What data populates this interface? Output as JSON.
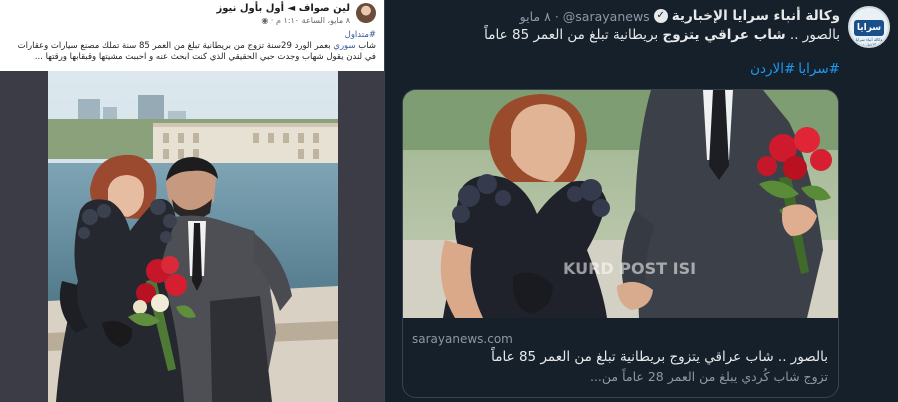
{
  "facebook_post": {
    "author_name": "لين صواف ◄ أول بأول نيوز",
    "timestamp": "٨ مايو، الساعة ١:١٠ م · ◉",
    "hashtag": "#متداول",
    "body_before": "شاب ",
    "body_highlight": "سوري",
    "body_after": " بعمر الورد 29سنة تزوج من بريطانية تبلغ من العمر 85 سنة تملك مصنع سيارات وعقارات في لندن يقول شهاب وجدت حبي الحقيقي الذي كنت ابحث عنه و احببت مشيتها وقبقابها ورقتها ..."
  },
  "tweet": {
    "display_name": "وكالة أنباء سرايا الإخبارية",
    "verified_icon": "verified-badge-icon",
    "handle": "@sarayanews",
    "separator": "·",
    "date": "٨ مايو",
    "text_prefix": "بالصور .. ",
    "text_bold": "شاب عراقي يتزوج",
    "text_suffix": " بريطانية تبلغ من العمر 85 عاماً",
    "hashtags": [
      "#سرايا",
      "#الاردن"
    ],
    "avatar_label": "سرايا",
    "avatar_sublabel": "وكالة أنباء سرايا الإخبارية",
    "link_card": {
      "domain": "sarayanews.com",
      "title": "بالصور .. شاب عراقي يتزوج بريطانية تبلغ من العمر 85 عاماً",
      "description": "تزوج شاب كُردي يبلغ من العمر 28 عاماً من...",
      "watermark": "KURD POST ISI"
    }
  },
  "colors": {
    "twitter_bg": "#15202b",
    "twitter_link": "#1d9bf0",
    "facebook_link": "#385898"
  }
}
